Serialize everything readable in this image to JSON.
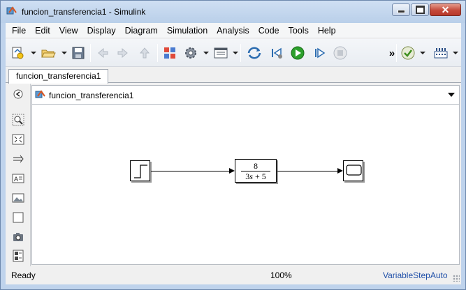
{
  "window": {
    "title": "funcion_transferencia1 - Simulink",
    "icon": "simulink-icon",
    "controls": [
      "minimize-icon",
      "maximize-icon",
      "close-icon"
    ],
    "close_glyph": "✕"
  },
  "menu": {
    "items": [
      {
        "id": "file",
        "label": "File"
      },
      {
        "id": "edit",
        "label": "Edit"
      },
      {
        "id": "view",
        "label": "View"
      },
      {
        "id": "display",
        "label": "Display"
      },
      {
        "id": "diagram",
        "label": "Diagram"
      },
      {
        "id": "simulation",
        "label": "Simulation"
      },
      {
        "id": "analysis",
        "label": "Analysis"
      },
      {
        "id": "code",
        "label": "Code"
      },
      {
        "id": "tools",
        "label": "Tools"
      },
      {
        "id": "help",
        "label": "Help"
      }
    ]
  },
  "toolbar": {
    "buttons": [
      "new-model-icon",
      "open-folder-icon",
      "save-icon",
      "back-icon",
      "forward-icon",
      "up-icon",
      "library-browser-icon",
      "model-config-gear-icon",
      "model-explorer-icon",
      "update-diagram-icon",
      "step-back-icon",
      "run-icon",
      "step-forward-icon",
      "stop-icon",
      "more-icon",
      "model-advisor-check-icon",
      "build-icon"
    ],
    "overflow_glyph": "»"
  },
  "tab": {
    "label": "funcion_transferencia1"
  },
  "address": {
    "path": "funcion_transferencia1"
  },
  "palette": {
    "tools": [
      "zoom-in-icon",
      "fit-to-view-icon",
      "arrow-direction-icon",
      "annotation-icon",
      "image-icon",
      "area-icon",
      "screenshot-camera-icon",
      "model-browser-icon"
    ]
  },
  "diagram": {
    "blocks": [
      {
        "id": "step",
        "type": "Step",
        "icon": "step-icon"
      },
      {
        "id": "transfer_fcn",
        "type": "Transfer Fcn",
        "numerator": "8",
        "denominator_s_coeff": "3",
        "denominator_var": "s",
        "denominator_op": " + ",
        "denominator_const": "5"
      },
      {
        "id": "scope",
        "type": "Scope",
        "icon": "scope-icon"
      }
    ]
  },
  "status": {
    "left": "Ready",
    "zoom": "100%",
    "solver": "VariableStepAuto"
  },
  "colors": {
    "title_bar": "#bfd3ec",
    "close_button": "#c4493a",
    "run_green": "#2ca02c",
    "status_link": "#1f4fa8"
  }
}
